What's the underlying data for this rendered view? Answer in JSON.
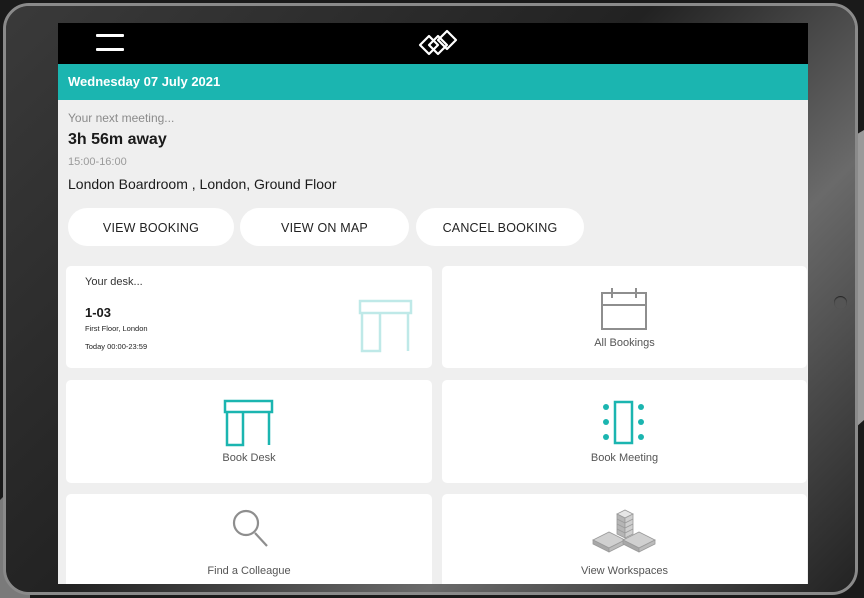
{
  "header": {
    "menu_icon": "hamburger-menu-icon",
    "logo_icon": "diamond-logo-icon",
    "date": "Wednesday 07 July 2021"
  },
  "next_meeting": {
    "label": "Your next meeting...",
    "countdown": "3h 56m away",
    "time": "15:00-16:00",
    "location": "London Boardroom , London, Ground Floor"
  },
  "actions": {
    "view_booking": "VIEW BOOKING",
    "view_on_map": "VIEW  ON MAP",
    "cancel_booking": "CANCEL BOOKING"
  },
  "desk_card": {
    "label": "Your desk...",
    "desk_id": "1-03",
    "floor": "First Floor, London",
    "hours": "Today 00:00-23:59",
    "icon": "desk-icon"
  },
  "tiles": {
    "all_bookings": {
      "label": "All Bookings",
      "icon": "calendar-icon"
    },
    "book_desk": {
      "label": "Book Desk",
      "icon": "desk-icon"
    },
    "book_meeting": {
      "label": "Book Meeting",
      "icon": "meeting-table-icon"
    },
    "find_colleague": {
      "label": "Find a Colleague",
      "icon": "search-icon"
    },
    "view_workspaces": {
      "label": "View Workspaces",
      "icon": "workspaces-3d-icon"
    }
  },
  "colors": {
    "accent": "#1bb5b0",
    "topbar": "#000000",
    "background": "#efefef",
    "card": "#ffffff",
    "icon_gray": "#8e8e8e"
  }
}
